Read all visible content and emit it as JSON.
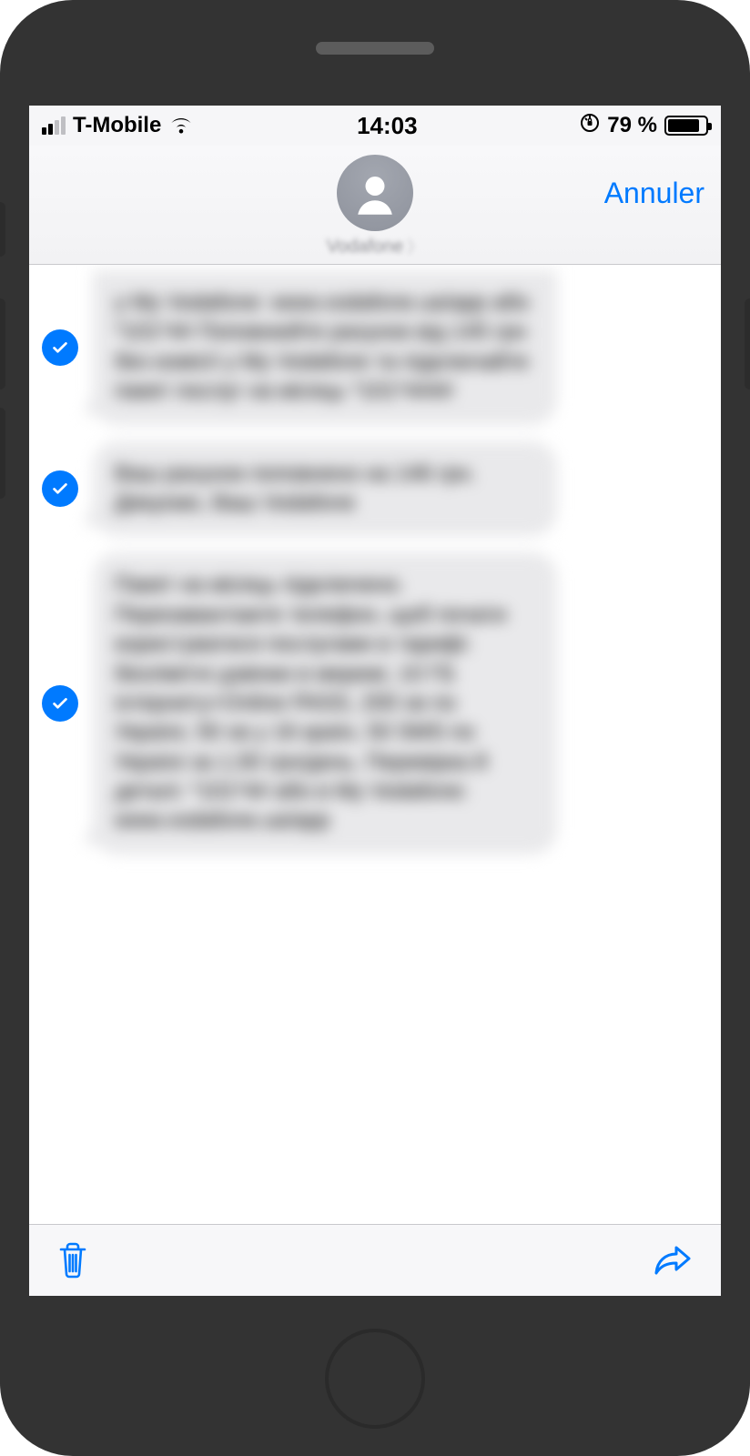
{
  "status": {
    "carrier": "T-Mobile",
    "time": "14:03",
    "battery_text": "79 %"
  },
  "nav": {
    "contact_name": "Vodafone",
    "cancel_label": "Annuler"
  },
  "messages": [
    {
      "selected": true,
      "text": "у My Vodafone: www.vodafone.ua/app або *101*4# Поповнюйте рахунок від 145 грн без комісії у My Vodafone та підключайте пакет послуг на місяць *101*444#"
    },
    {
      "selected": true,
      "text": "Ваш рахунок поповнено на 146 грн. Дякуємо, Ваш Vodafone"
    },
    {
      "selected": true,
      "text": "Пакет на місяць підключено. Перезавантажте телефон, щоб почати користуватися послугами в тарифі: безлімітні дзвінки в мережі, 10 ГБ інтернету+Online PASS, 200 хв по Україні, 50 хв у 16 країн, 50 SMS по Україні за 1,50 грн/день. Перевірка й деталі: *101*4# або в My Vodafone: www.vodafone.ua/app"
    }
  ]
}
